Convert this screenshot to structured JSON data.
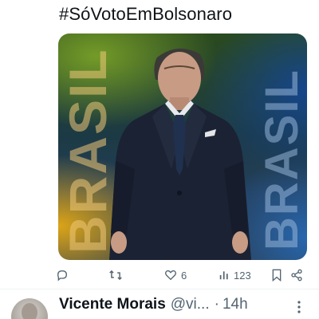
{
  "tweet": {
    "hashtag": "#SóVotoEmBolsonaro",
    "media": {
      "overlay_text_left": "BRASIL",
      "overlay_text_right": "BRASIL"
    },
    "actions": {
      "reply_icon": "reply-icon",
      "retweet_icon": "retweet-icon",
      "like_icon": "heart-icon",
      "like_count": "6",
      "views_icon": "views-icon",
      "views_count": "123",
      "bookmark_icon": "bookmark-icon",
      "share_icon": "share-icon"
    }
  },
  "next_tweet": {
    "author_name": "Vicente Morais",
    "author_handle": "@vi...",
    "time_prefix": "·",
    "time": "14h",
    "more_icon": "more-dots-icon"
  },
  "colors": {
    "text_primary": "#0f1419",
    "text_secondary": "#536471",
    "divider": "#eff3f4"
  }
}
